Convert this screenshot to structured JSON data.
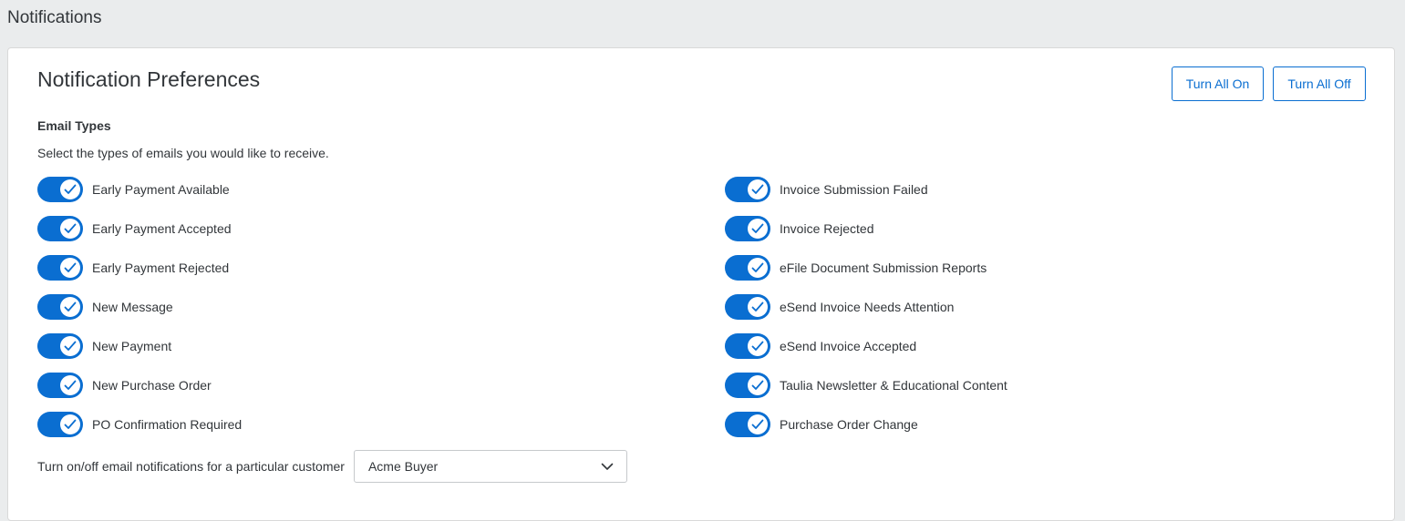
{
  "page": {
    "title": "Notifications"
  },
  "card": {
    "title": "Notification Preferences",
    "turn_all_on_label": "Turn All On",
    "turn_all_off_label": "Turn All Off"
  },
  "email_types": {
    "heading": "Email Types",
    "description": "Select the types of emails you would like to receive.",
    "left_column": [
      {
        "label": "Early Payment Available",
        "enabled": true
      },
      {
        "label": "Early Payment Accepted",
        "enabled": true
      },
      {
        "label": "Early Payment Rejected",
        "enabled": true
      },
      {
        "label": "New Message",
        "enabled": true
      },
      {
        "label": "New Payment",
        "enabled": true
      },
      {
        "label": "New Purchase Order",
        "enabled": true
      },
      {
        "label": "PO Confirmation Required",
        "enabled": true
      }
    ],
    "right_column": [
      {
        "label": "Invoice Submission Failed",
        "enabled": true
      },
      {
        "label": "Invoice Rejected",
        "enabled": true
      },
      {
        "label": "eFile Document Submission Reports",
        "enabled": true
      },
      {
        "label": "eSend Invoice Needs Attention",
        "enabled": true
      },
      {
        "label": "eSend Invoice Accepted",
        "enabled": true
      },
      {
        "label": "Taulia Newsletter & Educational Content",
        "enabled": true
      },
      {
        "label": "Purchase Order Change",
        "enabled": true
      }
    ]
  },
  "customer_filter": {
    "label": "Turn on/off email notifications for a particular customer",
    "selected": "Acme Buyer"
  },
  "colors": {
    "accent": "#0a6ed1",
    "background": "#eaeced",
    "text": "#32363a"
  },
  "icons": {
    "toggle_check": "check-icon",
    "select_chevron": "chevron-down-icon"
  }
}
